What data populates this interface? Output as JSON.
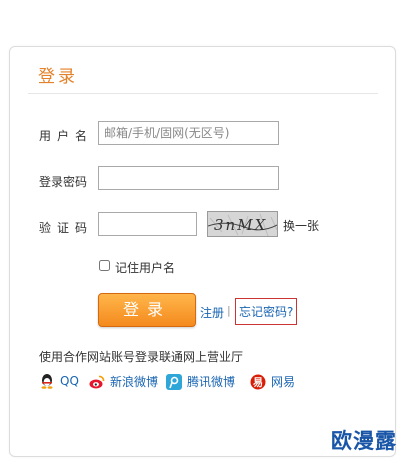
{
  "login_panel": {
    "title": "登录",
    "username": {
      "label": "用户名",
      "placeholder": "邮箱/手机/固网(无区号)"
    },
    "password": {
      "label": "登录密码"
    },
    "captcha": {
      "label": "验证码",
      "image_text": "3nMX",
      "change_label": "换一张"
    },
    "remember_label": "记住用户名",
    "submit_label": "登录",
    "register_label": "注册",
    "separator": "|",
    "forgot_label": "忘记密码?",
    "partner_intro": "使用合作网站账号登录联通网上营业厅",
    "partners": [
      {
        "name": "QQ",
        "icon": "penguin-icon"
      },
      {
        "name": "新浪微博",
        "icon": "weibo-icon"
      },
      {
        "name": "腾讯微博",
        "icon": "tencent-weibo-icon"
      },
      {
        "name": "网易",
        "icon": "netease-icon"
      }
    ]
  },
  "watermark": "欧漫露",
  "colors": {
    "accent": "#e3822a",
    "link": "#1a66b3",
    "button": "#f48a1e"
  }
}
